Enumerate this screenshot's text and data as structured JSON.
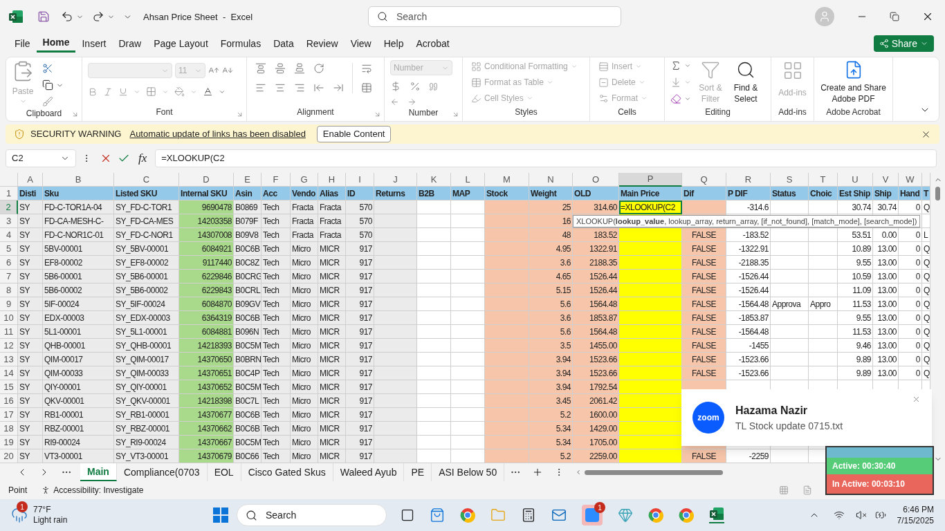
{
  "title_bar": {
    "title": "Ahsan Price Sheet  -  Excel",
    "search_placeholder": "Search"
  },
  "menu": [
    {
      "label": "File",
      "selected": false
    },
    {
      "label": "Home",
      "selected": true
    },
    {
      "label": "Insert",
      "selected": false
    },
    {
      "label": "Draw",
      "selected": false
    },
    {
      "label": "Page Layout",
      "selected": false
    },
    {
      "label": "Formulas",
      "selected": false
    },
    {
      "label": "Data",
      "selected": false
    },
    {
      "label": "Review",
      "selected": false
    },
    {
      "label": "View",
      "selected": false
    },
    {
      "label": "Help",
      "selected": false
    },
    {
      "label": "Acrobat",
      "selected": false
    }
  ],
  "share_button": "Share",
  "ribbon": [
    {
      "kind": "clipboard",
      "label": "Clipboard",
      "paste": {
        "label": "Paste",
        "disabled": true
      }
    },
    {
      "kind": "font",
      "label": "Font",
      "font_size": "11"
    },
    {
      "kind": "alignment",
      "label": "Alignment"
    },
    {
      "kind": "number",
      "label": "Number",
      "format": "Number"
    },
    {
      "kind": "styles",
      "label": "Styles",
      "items": [
        {
          "label": "Conditional Formatting",
          "disabled": true
        },
        {
          "label": "Format as Table",
          "disabled": true
        },
        {
          "label": "Cell Styles",
          "disabled": true
        }
      ]
    },
    {
      "kind": "cells",
      "label": "Cells",
      "items": [
        {
          "label": "Insert",
          "disabled": true
        },
        {
          "label": "Delete",
          "disabled": true
        },
        {
          "label": "Format",
          "disabled": true
        }
      ]
    },
    {
      "kind": "editing",
      "label": "Editing",
      "sort": {
        "label": "Sort & Filter",
        "disabled": true
      },
      "find": {
        "label": "Find & Select",
        "disabled": false
      }
    },
    {
      "kind": "addins",
      "label": "Add-ins",
      "button": {
        "label": "Add-ins",
        "disabled": true
      }
    },
    {
      "kind": "adobe",
      "label": "Adobe Acrobat",
      "button": {
        "label": "Create and Share Adobe PDF",
        "disabled": false
      }
    }
  ],
  "security_bar": {
    "title": "SECURITY WARNING",
    "message": "Automatic update of links has been disabled",
    "button": "Enable Content"
  },
  "formula_bar": {
    "name_box": "C2",
    "fx": "fx",
    "formula": "=XLOOKUP(C2"
  },
  "tooltip": "XLOOKUP(**lookup_value**, lookup_array, return_array, [if_not_found], [match_mode], [search_mode])",
  "columns": [
    {
      "letter": "A",
      "header": "Disti",
      "kind": "text",
      "color": "#ebebeb",
      "selected": false
    },
    {
      "letter": "B",
      "header": "Sku",
      "kind": "text",
      "color": "#ebebeb",
      "selected": false
    },
    {
      "letter": "C",
      "header": "Listed SKU",
      "kind": "text",
      "color": "#ebebeb",
      "selected": false
    },
    {
      "letter": "D",
      "header": "Internal SKU",
      "kind": "number",
      "color": "#a9d98b",
      "selected": false
    },
    {
      "letter": "E",
      "header": "Asin",
      "kind": "text",
      "color": "#ebebeb",
      "selected": false
    },
    {
      "letter": "F",
      "header": "Acc",
      "kind": "text",
      "color": "#ebebeb",
      "selected": false
    },
    {
      "letter": "G",
      "header": "Vendo",
      "kind": "text",
      "color": "#ebebeb",
      "selected": false
    },
    {
      "letter": "H",
      "header": "Alias",
      "kind": "text",
      "color": "#ebebeb",
      "selected": false
    },
    {
      "letter": "I",
      "header": "ID",
      "kind": "number",
      "color": "#ebebeb",
      "selected": false
    },
    {
      "letter": "J",
      "header": "Returns",
      "kind": "text",
      "color": "#ebebeb",
      "selected": false
    },
    {
      "letter": "K",
      "header": "B2B",
      "kind": "text",
      "color": "#ffffff",
      "selected": false
    },
    {
      "letter": "L",
      "header": "MAP",
      "kind": "text",
      "color": "#ffffff",
      "selected": false
    },
    {
      "letter": "M",
      "header": "Stock",
      "kind": "text",
      "color": "#f7c6aa",
      "selected": false
    },
    {
      "letter": "N",
      "header": "Weight",
      "kind": "number",
      "color": "#f7c6aa",
      "selected": false
    },
    {
      "letter": "O",
      "header": "OLD",
      "kind": "number",
      "color": "#f7c6aa",
      "selected": false
    },
    {
      "letter": "P",
      "header": "Main Price",
      "kind": "text",
      "color": "#ffff00",
      "selected": true
    },
    {
      "letter": "Q",
      "header": "Dif",
      "kind": "boolean",
      "color": "#f7c6aa",
      "selected": false
    },
    {
      "letter": "R",
      "header": "P DIF",
      "kind": "number",
      "color": "#ffffff",
      "selected": false
    },
    {
      "letter": "S",
      "header": "Status",
      "kind": "text",
      "color": "#ffffff",
      "selected": false
    },
    {
      "letter": "T",
      "header": "Choic",
      "kind": "text",
      "color": "#ffffff",
      "selected": false
    },
    {
      "letter": "U",
      "header": "Est Ship",
      "kind": "number",
      "color": "#ffffff",
      "selected": false
    },
    {
      "letter": "V",
      "header": "Ship",
      "kind": "number",
      "color": "#ffffff",
      "selected": false
    },
    {
      "letter": "W",
      "header": "Hand",
      "kind": "number",
      "color": "#ffffff",
      "selected": false
    },
    {
      "header": "T",
      "kind": "text",
      "color": "#ffffff",
      "selected": false
    }
  ],
  "header_row": {
    "number": "1",
    "selected": false
  },
  "rows": [
    {
      "number": "2",
      "selected": true,
      "cells": [
        "SY",
        "FD-C-TOR1A-04",
        "SY_FD-C-TOR1",
        "9690478",
        "B0869",
        "Tech",
        "Fracta",
        "Fracta",
        "570",
        null,
        null,
        null,
        null,
        "25",
        "314.60",
        "=XLOOKUP(C2",
        null,
        "-314.6",
        null,
        null,
        "30.74",
        "30.74",
        "0",
        "Q"
      ]
    },
    {
      "number": "3",
      "selected": false,
      "cells": [
        "SY",
        "FD-CA-MESH-C-",
        "SY_FD-CA-MES",
        "14203358",
        "B079F",
        "Tech",
        "Fracta",
        "Fracta",
        "570",
        null,
        null,
        null,
        null,
        "16",
        null,
        null,
        null,
        null,
        null,
        null,
        null,
        null,
        null,
        null
      ]
    },
    {
      "number": "4",
      "selected": false,
      "cells": [
        "SY",
        "FD-C-NOR1C-01",
        "SY_FD-C-NOR1",
        "14307008",
        "B09V8",
        "Tech",
        "Fracta",
        "Fracta",
        "570",
        null,
        null,
        null,
        null,
        "48",
        "183.52",
        null,
        "FALSE",
        "-183.52",
        null,
        null,
        "53.51",
        "0.00",
        "0",
        "L"
      ]
    },
    {
      "number": "5",
      "selected": false,
      "cells": [
        "SY",
        "5BV-00001",
        "SY_5BV-00001",
        "6084921",
        "B0C6B",
        "Tech",
        "Micro",
        "MICR",
        "917",
        null,
        null,
        null,
        null,
        "4.95",
        "1322.91",
        null,
        "FALSE",
        "-1322.91",
        null,
        null,
        "10.89",
        "13.00",
        "0",
        "Q"
      ]
    },
    {
      "number": "6",
      "selected": false,
      "cells": [
        "SY",
        "EF8-00002",
        "SY_EF8-00002",
        "9117440",
        "B0C8Z",
        "Tech",
        "Micro",
        "MICR",
        "917",
        null,
        null,
        null,
        null,
        "3.6",
        "2188.35",
        null,
        "FALSE",
        "-2188.35",
        null,
        null,
        "9.55",
        "13.00",
        "0",
        "Q"
      ]
    },
    {
      "number": "7",
      "selected": false,
      "cells": [
        "SY",
        "5B6-00001",
        "SY_5B6-00001",
        "6229846",
        "B0CRG",
        "Tech",
        "Micro",
        "MICR",
        "917",
        null,
        null,
        null,
        null,
        "4.65",
        "1526.44",
        null,
        "FALSE",
        "-1526.44",
        null,
        null,
        "10.59",
        "13.00",
        "0",
        "Q"
      ]
    },
    {
      "number": "8",
      "selected": false,
      "cells": [
        "SY",
        "5B6-00002",
        "SY_5B6-00002",
        "6229843",
        "B0CRL",
        "Tech",
        "Micro",
        "MICR",
        "917",
        null,
        null,
        null,
        null,
        "5.15",
        "1526.44",
        null,
        "FALSE",
        "-1526.44",
        null,
        null,
        "11.09",
        "13.00",
        "0",
        "Q"
      ]
    },
    {
      "number": "9",
      "selected": false,
      "cells": [
        "SY",
        "5IF-00024",
        "SY_5IF-00024",
        "6084870",
        "B09GV",
        "Tech",
        "Micro",
        "MICR",
        "917",
        null,
        null,
        null,
        null,
        "5.6",
        "1564.48",
        null,
        "FALSE",
        "-1564.48",
        "Approva",
        "Appro",
        "11.53",
        "13.00",
        "0",
        "Q"
      ]
    },
    {
      "number": "10",
      "selected": false,
      "cells": [
        "SY",
        "EDX-00003",
        "SY_EDX-00003",
        "6364319",
        "B0C6B",
        "Tech",
        "Micro",
        "MICR",
        "917",
        null,
        null,
        null,
        null,
        "3.6",
        "1853.87",
        null,
        "FALSE",
        "-1853.87",
        null,
        null,
        "9.55",
        "13.00",
        "0",
        "Q"
      ]
    },
    {
      "number": "11",
      "selected": false,
      "cells": [
        "SY",
        "5L1-00001",
        "SY_5L1-00001",
        "6084881",
        "B096N",
        "Tech",
        "Micro",
        "MICR",
        "917",
        null,
        null,
        null,
        null,
        "5.6",
        "1564.48",
        null,
        "FALSE",
        "-1564.48",
        null,
        null,
        "11.53",
        "13.00",
        "0",
        "Q"
      ]
    },
    {
      "number": "12",
      "selected": false,
      "cells": [
        "SY",
        "QHB-00001",
        "SY_QHB-00001",
        "14218393",
        "B0C5M",
        "Tech",
        "Micro",
        "MICR",
        "917",
        null,
        null,
        null,
        null,
        "3.5",
        "1455.00",
        null,
        "FALSE",
        "-1455",
        null,
        null,
        "9.46",
        "13.00",
        "0",
        "Q"
      ]
    },
    {
      "number": "13",
      "selected": false,
      "cells": [
        "SY",
        "QIM-00017",
        "SY_QIM-00017",
        "14370650",
        "B0BRN",
        "Tech",
        "Micro",
        "MICR",
        "917",
        null,
        null,
        null,
        null,
        "3.94",
        "1523.66",
        null,
        "FALSE",
        "-1523.66",
        null,
        null,
        "9.89",
        "13.00",
        "0",
        "Q"
      ]
    },
    {
      "number": "14",
      "selected": false,
      "cells": [
        "SY",
        "QIM-00033",
        "SY_QIM-00033",
        "14370651",
        "B0C4P",
        "Tech",
        "Micro",
        "MICR",
        "917",
        null,
        null,
        null,
        null,
        "3.94",
        "1523.66",
        null,
        "FALSE",
        "-1523.66",
        null,
        null,
        "9.89",
        "13.00",
        "0",
        "Q"
      ]
    },
    {
      "number": "15",
      "selected": false,
      "cells": [
        "SY",
        "QIY-00001",
        "SY_QIY-00001",
        "14370652",
        "B0C5M",
        "Tech",
        "Micro",
        "MICR",
        "917",
        null,
        null,
        null,
        null,
        "3.94",
        "1792.54",
        null,
        null,
        null,
        null,
        null,
        null,
        null,
        null,
        null
      ]
    },
    {
      "number": "16",
      "selected": false,
      "cells": [
        "SY",
        "QKV-00001",
        "SY_QKV-00001",
        "14218398",
        "B0C7L",
        "Tech",
        "Micro",
        "MICR",
        "917",
        null,
        null,
        null,
        null,
        "3.45",
        "2061.42",
        null,
        null,
        null,
        null,
        null,
        null,
        null,
        null,
        null
      ]
    },
    {
      "number": "17",
      "selected": false,
      "cells": [
        "SY",
        "RB1-00001",
        "SY_RB1-00001",
        "14370677",
        "B0C6B",
        "Tech",
        "Micro",
        "MICR",
        "917",
        null,
        null,
        null,
        null,
        "5.2",
        "1600.00",
        null,
        null,
        null,
        null,
        null,
        null,
        null,
        null,
        null
      ]
    },
    {
      "number": "18",
      "selected": false,
      "cells": [
        "SY",
        "RBZ-00001",
        "SY_RBZ-00001",
        "14370662",
        "B0C6B",
        "Tech",
        "Micro",
        "MICR",
        "917",
        null,
        null,
        null,
        null,
        "5.34",
        "1429.00",
        null,
        null,
        null,
        null,
        null,
        null,
        null,
        null,
        null
      ]
    },
    {
      "number": "19",
      "selected": false,
      "cells": [
        "SY",
        "RI9-00024",
        "SY_RI9-00024",
        "14370667",
        "B0C5M",
        "Tech",
        "Micro",
        "MICR",
        "917",
        null,
        null,
        null,
        null,
        "5.34",
        "1705.00",
        null,
        null,
        null,
        null,
        null,
        null,
        null,
        null,
        null
      ]
    },
    {
      "number": "20",
      "selected": false,
      "cells": [
        "SY",
        "VT3-00001",
        "SY_VT3-00001",
        "14370679",
        "B0C66",
        "Tech",
        "Micro",
        "MICR",
        "917",
        null,
        null,
        null,
        null,
        "5.2",
        "2259.00",
        null,
        "FALSE",
        "-2259",
        null,
        null,
        null,
        null,
        null,
        null
      ]
    }
  ],
  "sheet_tabs": [
    {
      "label": "Main",
      "selected": true
    },
    {
      "label": "Compliance(0703",
      "selected": false
    },
    {
      "label": "EOL",
      "selected": false
    },
    {
      "label": "Cisco Gated Skus",
      "selected": false
    },
    {
      "label": "Waleed Ayub",
      "selected": false
    },
    {
      "label": "PE",
      "selected": false
    },
    {
      "label": "ASI Below 50",
      "selected": false
    }
  ],
  "status_bar": {
    "mode": "Point",
    "accessibility": "Accessibility: Investigate"
  },
  "notification": {
    "logo_text": "zoom",
    "title": "Hazama Nazir",
    "message": "TL Stock update 0715.txt"
  },
  "timer": {
    "active": "Active: 00:30:40",
    "inactive": "In Active: 00:03:10"
  },
  "taskbar": {
    "weather_badge": "1",
    "temperature": "77°F",
    "condition": "Light rain",
    "search_placeholder": "Search",
    "app_badge": "1",
    "time": "6:46 PM",
    "date": "7/15/2025"
  }
}
